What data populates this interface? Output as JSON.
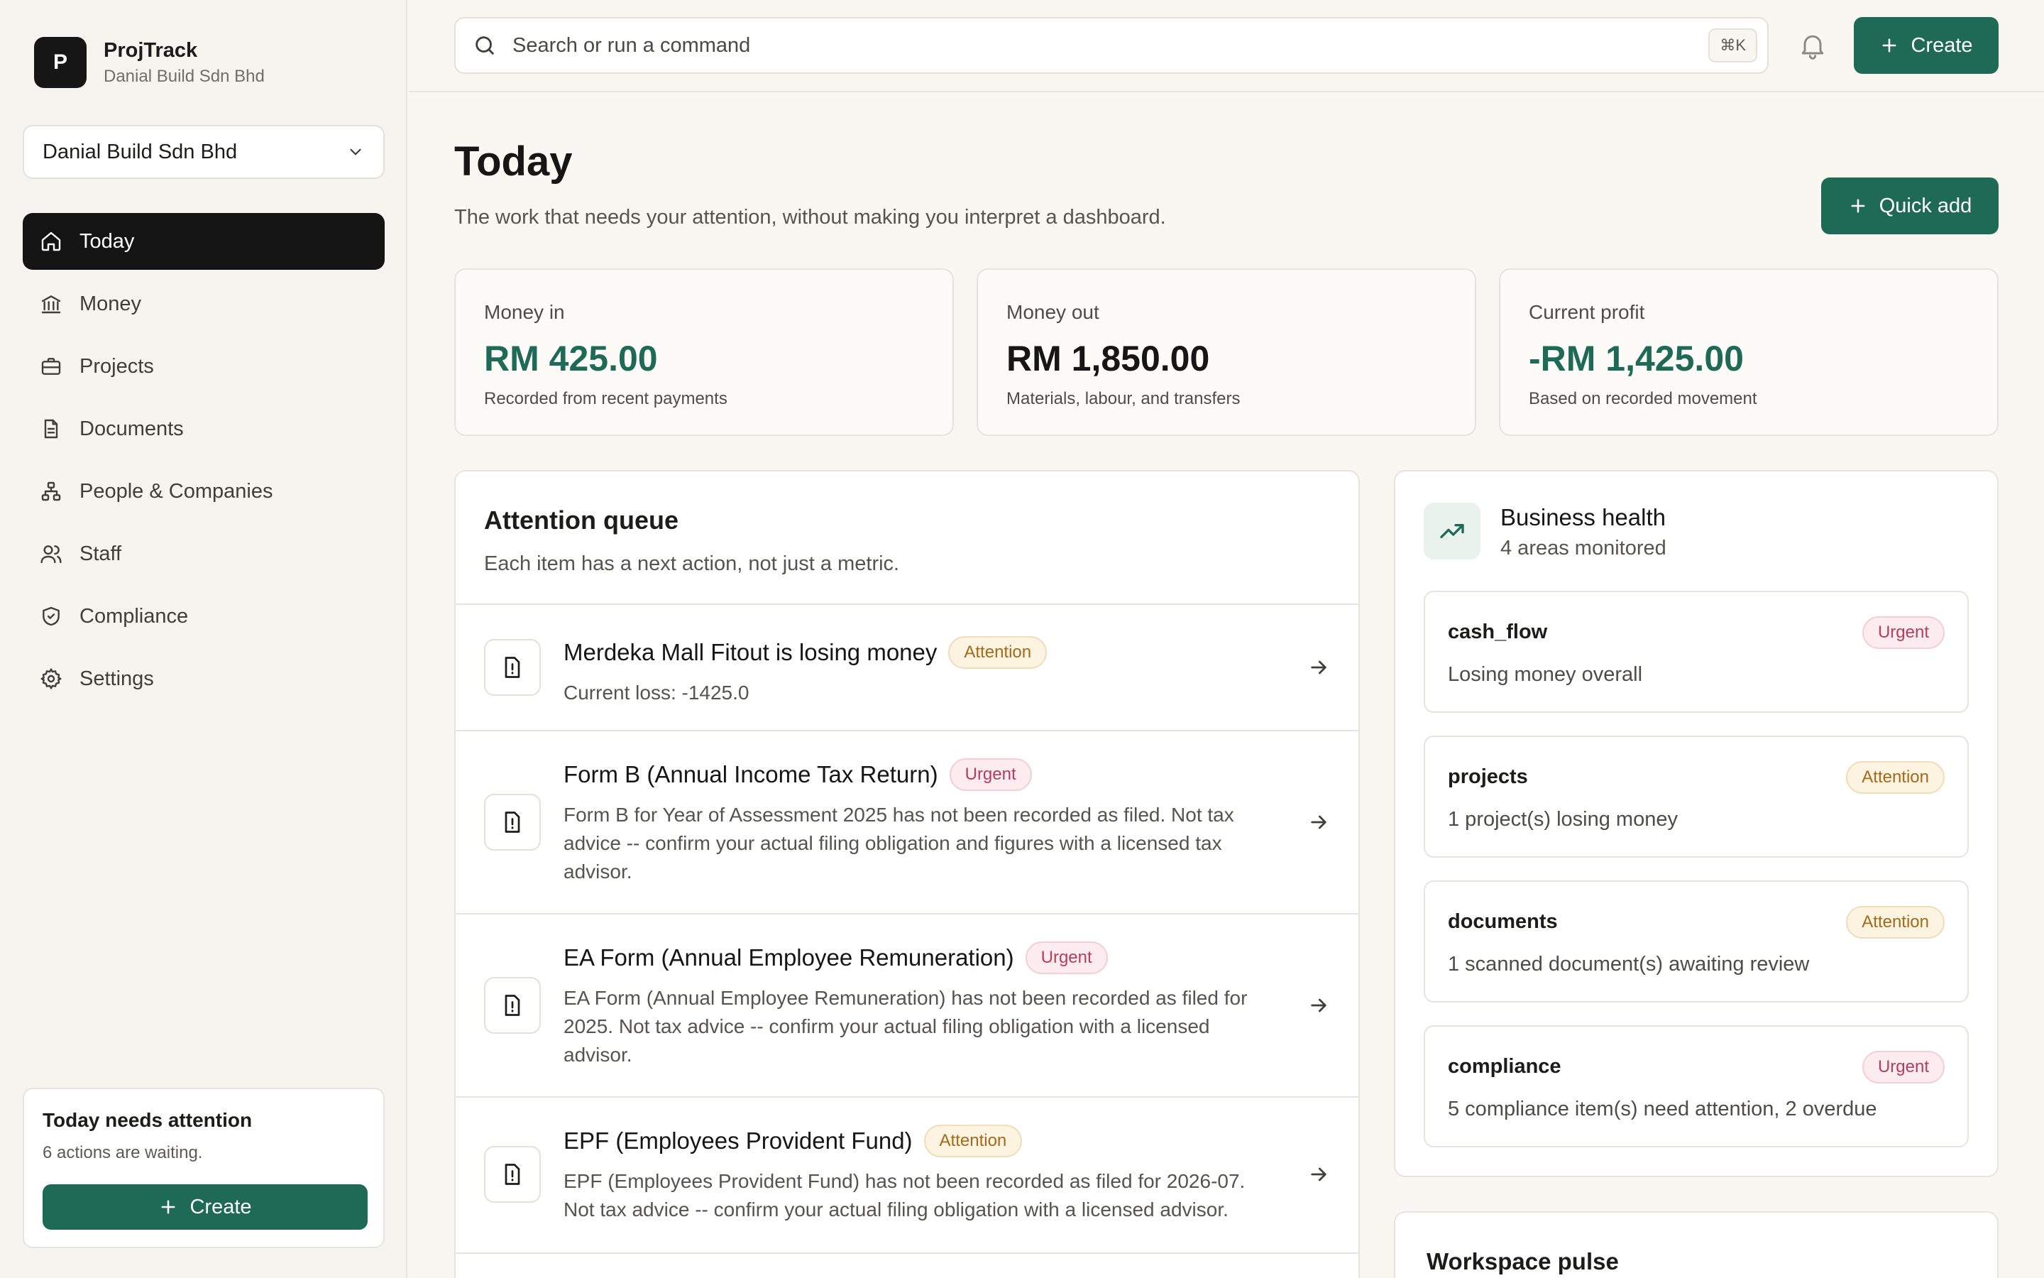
{
  "brand": {
    "initial": "P",
    "name": "ProjTrack",
    "company": "Danial Build Sdn Bhd"
  },
  "org_select": {
    "value": "Danial Build Sdn Bhd"
  },
  "nav": [
    {
      "label": "Today",
      "icon": "home-icon",
      "active": true
    },
    {
      "label": "Money",
      "icon": "bank-icon"
    },
    {
      "label": "Projects",
      "icon": "briefcase-icon"
    },
    {
      "label": "Documents",
      "icon": "document-icon"
    },
    {
      "label": "People & Companies",
      "icon": "org-chart-icon"
    },
    {
      "label": "Staff",
      "icon": "users-icon"
    },
    {
      "label": "Compliance",
      "icon": "shield-icon"
    },
    {
      "label": "Settings",
      "icon": "gear-icon"
    }
  ],
  "sidebar_card": {
    "title": "Today needs attention",
    "subtitle": "6 actions are waiting.",
    "button": "Create"
  },
  "topbar": {
    "search_placeholder": "Search or run a command",
    "shortcut": "⌘K",
    "create": "Create"
  },
  "page": {
    "title": "Today",
    "subtitle": "The work that needs your attention, without making you interpret a dashboard.",
    "quick_add": "Quick add"
  },
  "stats": [
    {
      "label": "Money in",
      "value": "RM 425.00",
      "note": "Recorded from recent payments",
      "color": "#1f6a56"
    },
    {
      "label": "Money out",
      "value": "RM 1,850.00",
      "note": "Materials, labour, and transfers",
      "color": "#161616"
    },
    {
      "label": "Current profit",
      "value": "-RM 1,425.00",
      "note": "Based on recorded movement",
      "color": "#1f6a56"
    }
  ],
  "queue": {
    "title": "Attention queue",
    "subtitle": "Each item has a next action, not just a metric.",
    "items": [
      {
        "title": "Merdeka Mall Fitout is losing money",
        "badge": "Attention",
        "desc": "Current loss: -1425.0"
      },
      {
        "title": "Form B (Annual Income Tax Return)",
        "badge": "Urgent",
        "desc": "Form B for Year of Assessment 2025 has not been recorded as filed. Not tax advice -- confirm your actual filing obligation and figures with a licensed tax advisor."
      },
      {
        "title": "EA Form (Annual Employee Remuneration)",
        "badge": "Urgent",
        "desc": "EA Form (Annual Employee Remuneration) has not been recorded as filed for 2025. Not tax advice -- confirm your actual filing obligation with a licensed advisor."
      },
      {
        "title": "EPF (Employees Provident Fund)",
        "badge": "Attention",
        "desc": "EPF (Employees Provident Fund) has not been recorded as filed for 2026-07. Not tax advice -- confirm your actual filing obligation with a licensed advisor."
      }
    ]
  },
  "health": {
    "title": "Business health",
    "subtitle": "4 areas monitored",
    "cards": [
      {
        "name": "cash_flow",
        "badge": "Urgent",
        "desc": "Losing money overall"
      },
      {
        "name": "projects",
        "badge": "Attention",
        "desc": "1 project(s) losing money"
      },
      {
        "name": "documents",
        "badge": "Attention",
        "desc": "1 scanned document(s) awaiting review"
      },
      {
        "name": "compliance",
        "badge": "Urgent",
        "desc": "5 compliance item(s) need attention, 2 overdue"
      }
    ]
  },
  "pulse": {
    "title": "Workspace pulse"
  },
  "colors": {
    "accent": "#1f6a56",
    "urgent": "#b23f5c",
    "attention": "#a36a1a"
  }
}
